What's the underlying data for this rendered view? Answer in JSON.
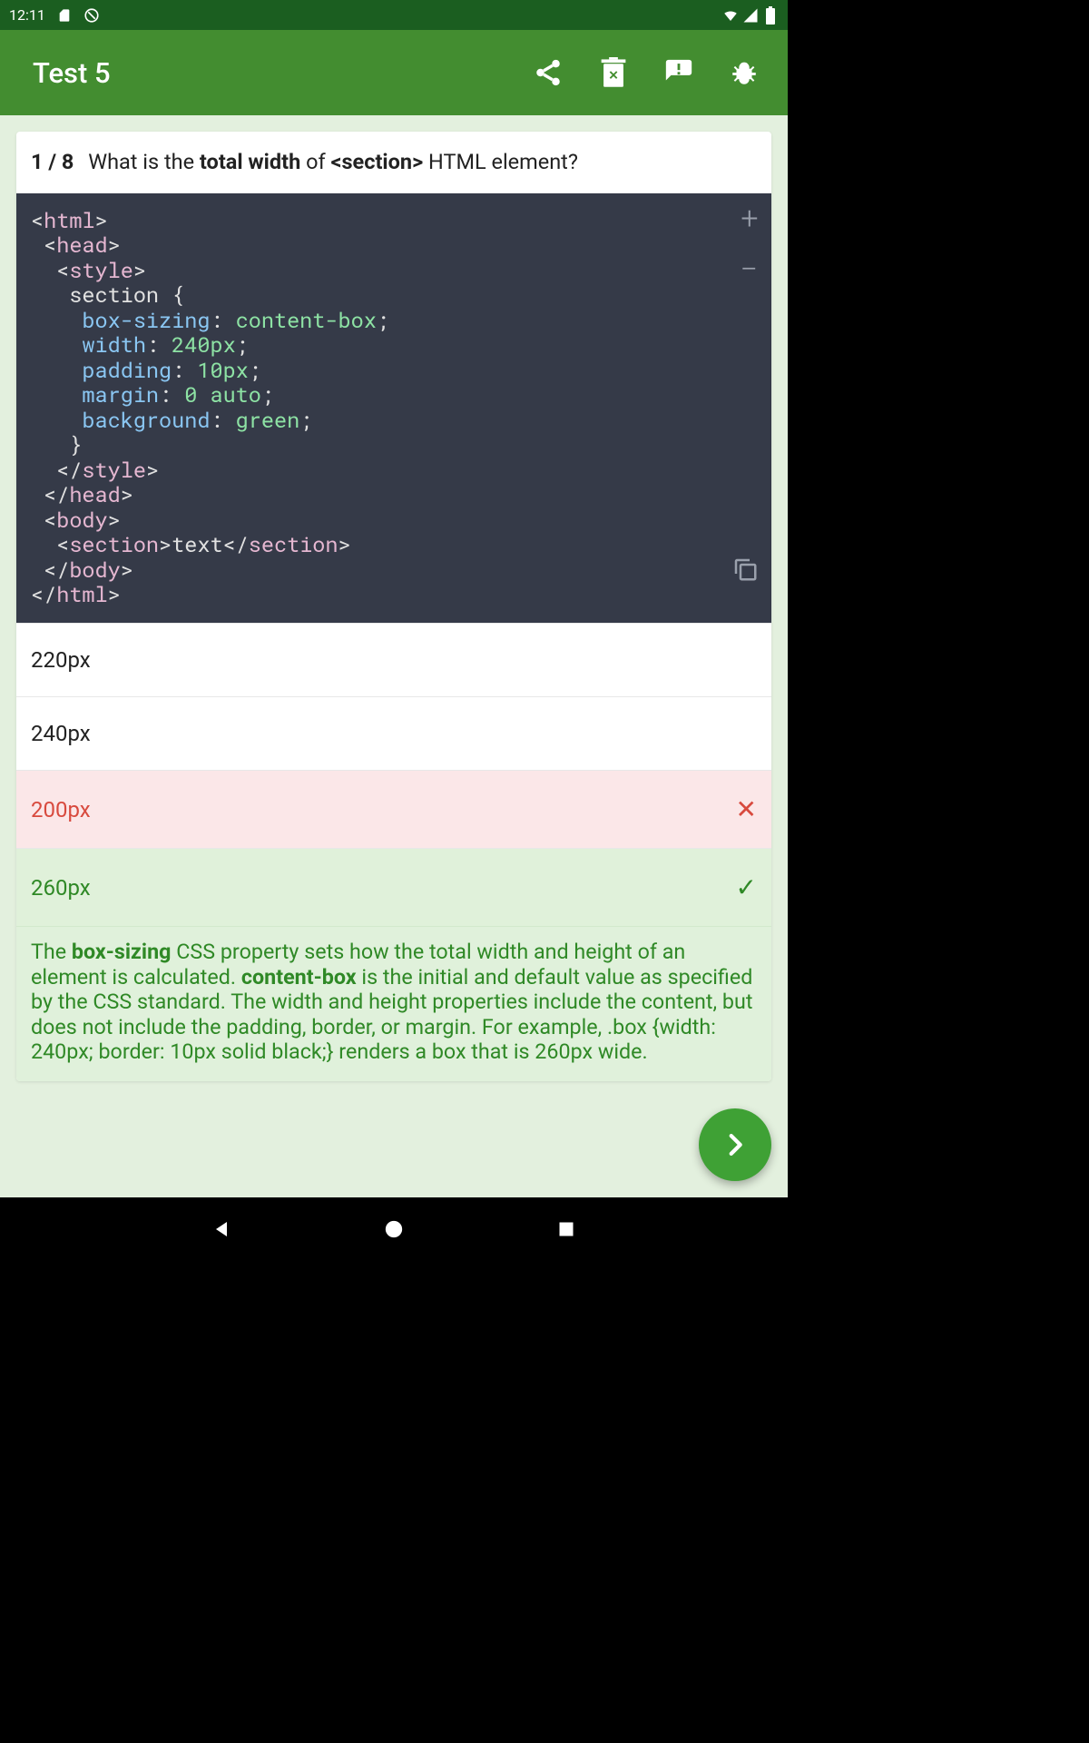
{
  "status_bar": {
    "time": "12:11"
  },
  "app_bar": {
    "title": "Test 5"
  },
  "question": {
    "counter": "1 / 8",
    "q_prefix": "What is the ",
    "q_bold1": "total width",
    "q_mid": " of ",
    "q_bold2": "<section>",
    "q_suffix": " HTML element?"
  },
  "code": {
    "l1_a": "<",
    "l1_b": "html",
    "l1_c": ">",
    "l2_a": " <",
    "l2_b": "head",
    "l2_c": ">",
    "l3_a": "  <",
    "l3_b": "style",
    "l3_c": ">",
    "l4": "   section {",
    "l5_a": "    ",
    "l5_k": "box-sizing",
    "l5_c": ": ",
    "l5_v": "content-box",
    "l5_e": ";",
    "l6_a": "    ",
    "l6_k": "width",
    "l6_c": ": ",
    "l6_v": "240px",
    "l6_e": ";",
    "l7_a": "    ",
    "l7_k": "padding",
    "l7_c": ": ",
    "l7_v": "10px",
    "l7_e": ";",
    "l8_a": "    ",
    "l8_k": "margin",
    "l8_c": ": ",
    "l8_v": "0 auto",
    "l8_e": ";",
    "l9_a": "    ",
    "l9_k": "background",
    "l9_c": ": ",
    "l9_v": "green",
    "l9_e": ";",
    "l10": "   }",
    "l11_a": "  </",
    "l11_b": "style",
    "l11_c": ">",
    "l12_a": " </",
    "l12_b": "head",
    "l12_c": ">",
    "l13_a": " <",
    "l13_b": "body",
    "l13_c": ">",
    "l14_a": "  <",
    "l14_b": "section",
    "l14_c": ">",
    "l14_t": "text",
    "l14_d": "</",
    "l14_e": "section",
    "l14_f": ">",
    "l15_a": " </",
    "l15_b": "body",
    "l15_c": ">",
    "l16_a": "</",
    "l16_b": "html",
    "l16_c": ">"
  },
  "answers": [
    {
      "label": "220px",
      "state": "default"
    },
    {
      "label": "240px",
      "state": "default"
    },
    {
      "label": "200px",
      "state": "wrong"
    },
    {
      "label": "260px",
      "state": "correct"
    }
  ],
  "explanation": {
    "p1": "The ",
    "b1": "box-sizing",
    "p2": " CSS property sets how the total width and height of an element is calculated. ",
    "b2": "content-box",
    "p3": " is the initial and default value as specified by the CSS standard. The width and height properties include the content, but does not include the padding, border, or margin. For example, .box {width: 240px; border: 10px solid black;} renders a box that is 260px wide."
  },
  "code_controls": {
    "plus": "+",
    "minus": "−"
  },
  "marks": {
    "cross": "✕",
    "check": "✓"
  }
}
